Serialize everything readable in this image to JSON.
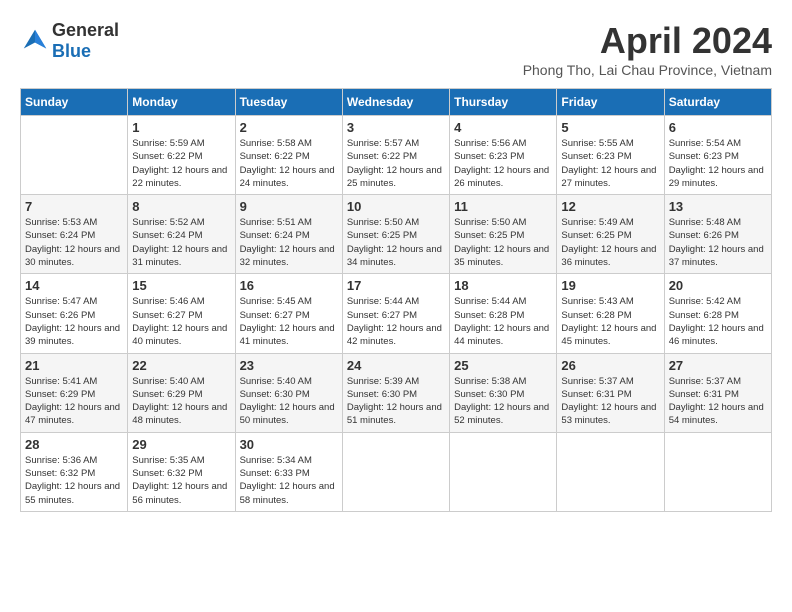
{
  "header": {
    "logo": {
      "general": "General",
      "blue": "Blue"
    },
    "title": "April 2024",
    "location": "Phong Tho, Lai Chau Province, Vietnam"
  },
  "calendar": {
    "days_of_week": [
      "Sunday",
      "Monday",
      "Tuesday",
      "Wednesday",
      "Thursday",
      "Friday",
      "Saturday"
    ],
    "weeks": [
      [
        {
          "day": "",
          "sunrise": "",
          "sunset": "",
          "daylight": "",
          "empty": true
        },
        {
          "day": "1",
          "sunrise": "Sunrise: 5:59 AM",
          "sunset": "Sunset: 6:22 PM",
          "daylight": "Daylight: 12 hours and 22 minutes.",
          "empty": false
        },
        {
          "day": "2",
          "sunrise": "Sunrise: 5:58 AM",
          "sunset": "Sunset: 6:22 PM",
          "daylight": "Daylight: 12 hours and 24 minutes.",
          "empty": false
        },
        {
          "day": "3",
          "sunrise": "Sunrise: 5:57 AM",
          "sunset": "Sunset: 6:22 PM",
          "daylight": "Daylight: 12 hours and 25 minutes.",
          "empty": false
        },
        {
          "day": "4",
          "sunrise": "Sunrise: 5:56 AM",
          "sunset": "Sunset: 6:23 PM",
          "daylight": "Daylight: 12 hours and 26 minutes.",
          "empty": false
        },
        {
          "day": "5",
          "sunrise": "Sunrise: 5:55 AM",
          "sunset": "Sunset: 6:23 PM",
          "daylight": "Daylight: 12 hours and 27 minutes.",
          "empty": false
        },
        {
          "day": "6",
          "sunrise": "Sunrise: 5:54 AM",
          "sunset": "Sunset: 6:23 PM",
          "daylight": "Daylight: 12 hours and 29 minutes.",
          "empty": false
        }
      ],
      [
        {
          "day": "7",
          "sunrise": "Sunrise: 5:53 AM",
          "sunset": "Sunset: 6:24 PM",
          "daylight": "Daylight: 12 hours and 30 minutes.",
          "empty": false
        },
        {
          "day": "8",
          "sunrise": "Sunrise: 5:52 AM",
          "sunset": "Sunset: 6:24 PM",
          "daylight": "Daylight: 12 hours and 31 minutes.",
          "empty": false
        },
        {
          "day": "9",
          "sunrise": "Sunrise: 5:51 AM",
          "sunset": "Sunset: 6:24 PM",
          "daylight": "Daylight: 12 hours and 32 minutes.",
          "empty": false
        },
        {
          "day": "10",
          "sunrise": "Sunrise: 5:50 AM",
          "sunset": "Sunset: 6:25 PM",
          "daylight": "Daylight: 12 hours and 34 minutes.",
          "empty": false
        },
        {
          "day": "11",
          "sunrise": "Sunrise: 5:50 AM",
          "sunset": "Sunset: 6:25 PM",
          "daylight": "Daylight: 12 hours and 35 minutes.",
          "empty": false
        },
        {
          "day": "12",
          "sunrise": "Sunrise: 5:49 AM",
          "sunset": "Sunset: 6:25 PM",
          "daylight": "Daylight: 12 hours and 36 minutes.",
          "empty": false
        },
        {
          "day": "13",
          "sunrise": "Sunrise: 5:48 AM",
          "sunset": "Sunset: 6:26 PM",
          "daylight": "Daylight: 12 hours and 37 minutes.",
          "empty": false
        }
      ],
      [
        {
          "day": "14",
          "sunrise": "Sunrise: 5:47 AM",
          "sunset": "Sunset: 6:26 PM",
          "daylight": "Daylight: 12 hours and 39 minutes.",
          "empty": false
        },
        {
          "day": "15",
          "sunrise": "Sunrise: 5:46 AM",
          "sunset": "Sunset: 6:27 PM",
          "daylight": "Daylight: 12 hours and 40 minutes.",
          "empty": false
        },
        {
          "day": "16",
          "sunrise": "Sunrise: 5:45 AM",
          "sunset": "Sunset: 6:27 PM",
          "daylight": "Daylight: 12 hours and 41 minutes.",
          "empty": false
        },
        {
          "day": "17",
          "sunrise": "Sunrise: 5:44 AM",
          "sunset": "Sunset: 6:27 PM",
          "daylight": "Daylight: 12 hours and 42 minutes.",
          "empty": false
        },
        {
          "day": "18",
          "sunrise": "Sunrise: 5:44 AM",
          "sunset": "Sunset: 6:28 PM",
          "daylight": "Daylight: 12 hours and 44 minutes.",
          "empty": false
        },
        {
          "day": "19",
          "sunrise": "Sunrise: 5:43 AM",
          "sunset": "Sunset: 6:28 PM",
          "daylight": "Daylight: 12 hours and 45 minutes.",
          "empty": false
        },
        {
          "day": "20",
          "sunrise": "Sunrise: 5:42 AM",
          "sunset": "Sunset: 6:28 PM",
          "daylight": "Daylight: 12 hours and 46 minutes.",
          "empty": false
        }
      ],
      [
        {
          "day": "21",
          "sunrise": "Sunrise: 5:41 AM",
          "sunset": "Sunset: 6:29 PM",
          "daylight": "Daylight: 12 hours and 47 minutes.",
          "empty": false
        },
        {
          "day": "22",
          "sunrise": "Sunrise: 5:40 AM",
          "sunset": "Sunset: 6:29 PM",
          "daylight": "Daylight: 12 hours and 48 minutes.",
          "empty": false
        },
        {
          "day": "23",
          "sunrise": "Sunrise: 5:40 AM",
          "sunset": "Sunset: 6:30 PM",
          "daylight": "Daylight: 12 hours and 50 minutes.",
          "empty": false
        },
        {
          "day": "24",
          "sunrise": "Sunrise: 5:39 AM",
          "sunset": "Sunset: 6:30 PM",
          "daylight": "Daylight: 12 hours and 51 minutes.",
          "empty": false
        },
        {
          "day": "25",
          "sunrise": "Sunrise: 5:38 AM",
          "sunset": "Sunset: 6:30 PM",
          "daylight": "Daylight: 12 hours and 52 minutes.",
          "empty": false
        },
        {
          "day": "26",
          "sunrise": "Sunrise: 5:37 AM",
          "sunset": "Sunset: 6:31 PM",
          "daylight": "Daylight: 12 hours and 53 minutes.",
          "empty": false
        },
        {
          "day": "27",
          "sunrise": "Sunrise: 5:37 AM",
          "sunset": "Sunset: 6:31 PM",
          "daylight": "Daylight: 12 hours and 54 minutes.",
          "empty": false
        }
      ],
      [
        {
          "day": "28",
          "sunrise": "Sunrise: 5:36 AM",
          "sunset": "Sunset: 6:32 PM",
          "daylight": "Daylight: 12 hours and 55 minutes.",
          "empty": false
        },
        {
          "day": "29",
          "sunrise": "Sunrise: 5:35 AM",
          "sunset": "Sunset: 6:32 PM",
          "daylight": "Daylight: 12 hours and 56 minutes.",
          "empty": false
        },
        {
          "day": "30",
          "sunrise": "Sunrise: 5:34 AM",
          "sunset": "Sunset: 6:33 PM",
          "daylight": "Daylight: 12 hours and 58 minutes.",
          "empty": false
        },
        {
          "day": "",
          "sunrise": "",
          "sunset": "",
          "daylight": "",
          "empty": true
        },
        {
          "day": "",
          "sunrise": "",
          "sunset": "",
          "daylight": "",
          "empty": true
        },
        {
          "day": "",
          "sunrise": "",
          "sunset": "",
          "daylight": "",
          "empty": true
        },
        {
          "day": "",
          "sunrise": "",
          "sunset": "",
          "daylight": "",
          "empty": true
        }
      ]
    ]
  }
}
